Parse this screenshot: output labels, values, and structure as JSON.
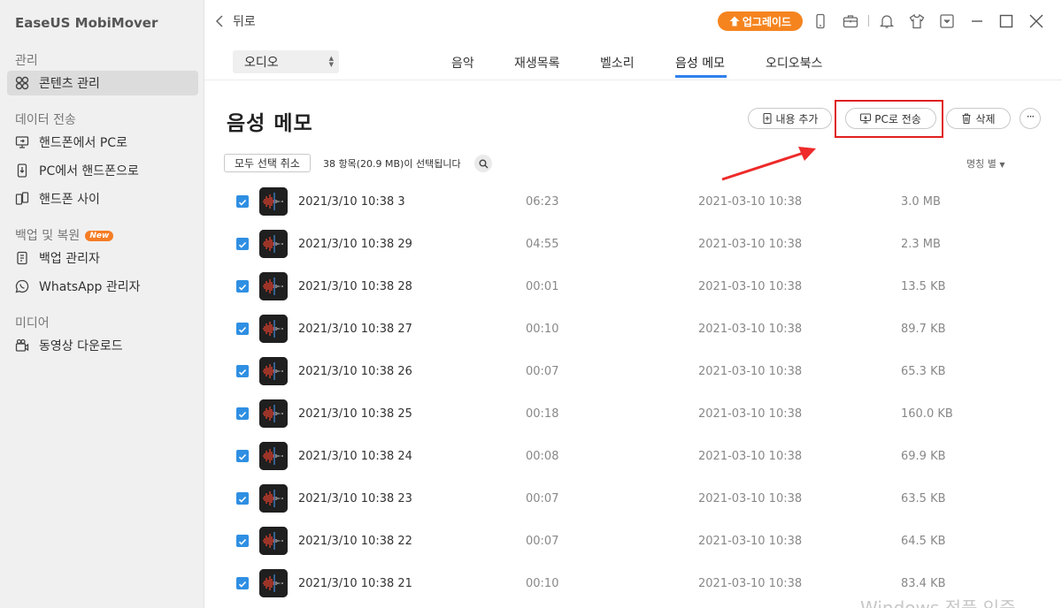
{
  "app": {
    "title": "EaseUS MobiMover"
  },
  "sidebar": {
    "sections": [
      {
        "title": "관리",
        "items": [
          {
            "label": "콘텐츠 관리",
            "icon": "grid-icon",
            "active": true
          }
        ]
      },
      {
        "title": "데이터 전송",
        "items": [
          {
            "label": "핸드폰에서 PC로",
            "icon": "phone-to-pc-icon"
          },
          {
            "label": "PC에서 핸드폰으로",
            "icon": "pc-to-phone-icon"
          },
          {
            "label": "핸드폰 사이",
            "icon": "phone-to-phone-icon"
          }
        ]
      },
      {
        "title": "백업 및 복원",
        "badge": "New",
        "items": [
          {
            "label": "백업 관리자",
            "icon": "backup-icon"
          },
          {
            "label": "WhatsApp 관리자",
            "icon": "whatsapp-icon"
          }
        ]
      },
      {
        "title": "미디어",
        "items": [
          {
            "label": "동영상 다운로드",
            "icon": "video-download-icon"
          }
        ]
      }
    ]
  },
  "topbar": {
    "back_label": "뒤로",
    "upgrade_label": "업그레이드"
  },
  "subbar": {
    "category": "오디오",
    "tabs": [
      {
        "label": "음악"
      },
      {
        "label": "재생목록"
      },
      {
        "label": "벨소리"
      },
      {
        "label": "음성 메모",
        "active": true
      },
      {
        "label": "오디오북스"
      }
    ]
  },
  "content": {
    "title": "음성 메모",
    "actions": {
      "add": "내용 추가",
      "to_pc": "PC로 전송",
      "delete": "삭제"
    },
    "deselect_all": "모두 선택 취소",
    "selection_text": "38 항목(20.9 MB)이 선택됩니다",
    "sort_label": "명칭 별"
  },
  "rows": [
    {
      "name": "2021/3/10 10:38 3",
      "duration": "06:23",
      "date": "2021-03-10 10:38",
      "size": "3.0 MB"
    },
    {
      "name": "2021/3/10 10:38 29",
      "duration": "04:55",
      "date": "2021-03-10 10:38",
      "size": "2.3 MB"
    },
    {
      "name": "2021/3/10 10:38 28",
      "duration": "00:01",
      "date": "2021-03-10 10:38",
      "size": "13.5 KB"
    },
    {
      "name": "2021/3/10 10:38 27",
      "duration": "00:10",
      "date": "2021-03-10 10:38",
      "size": "89.7 KB"
    },
    {
      "name": "2021/3/10 10:38 26",
      "duration": "00:07",
      "date": "2021-03-10 10:38",
      "size": "65.3 KB"
    },
    {
      "name": "2021/3/10 10:38 25",
      "duration": "00:18",
      "date": "2021-03-10 10:38",
      "size": "160.0 KB"
    },
    {
      "name": "2021/3/10 10:38 24",
      "duration": "00:08",
      "date": "2021-03-10 10:38",
      "size": "69.9 KB"
    },
    {
      "name": "2021/3/10 10:38 23",
      "duration": "00:07",
      "date": "2021-03-10 10:38",
      "size": "63.5 KB"
    },
    {
      "name": "2021/3/10 10:38 22",
      "duration": "00:07",
      "date": "2021-03-10 10:38",
      "size": "64.5 KB"
    },
    {
      "name": "2021/3/10 10:38 21",
      "duration": "00:10",
      "date": "2021-03-10 10:38",
      "size": "83.4 KB"
    }
  ],
  "watermark": "Windows 정품 인증",
  "colors": {
    "accent": "#2f80ed",
    "upgrade": "#f5841f",
    "highlight": "#e02020",
    "badge": "#f57c24"
  }
}
